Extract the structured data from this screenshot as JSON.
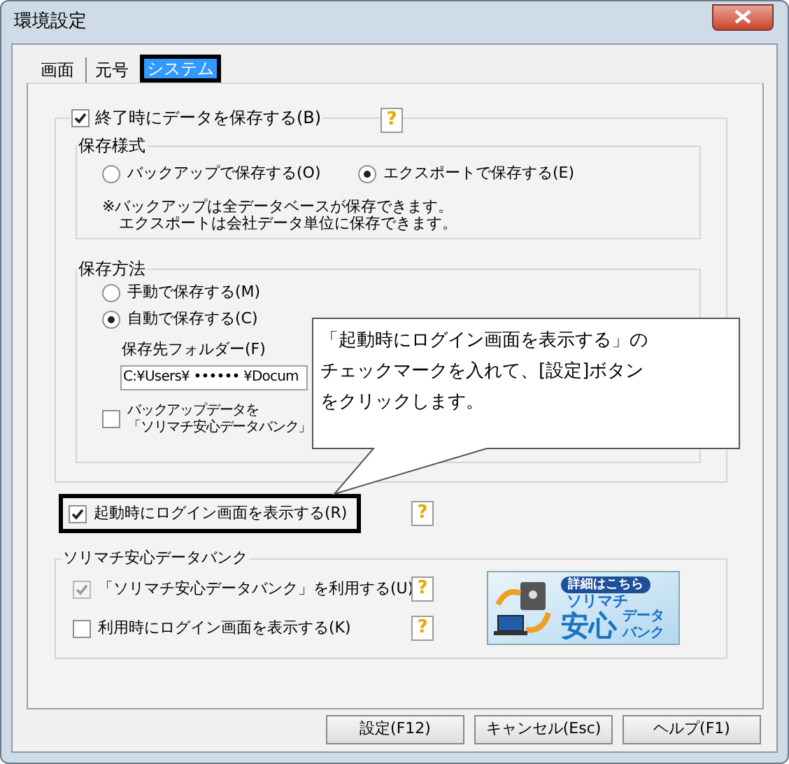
{
  "window": {
    "title": "環境設定"
  },
  "tabs": [
    {
      "label": "画面",
      "selected": false
    },
    {
      "label": "元号",
      "selected": false
    },
    {
      "label": "システム",
      "selected": true
    }
  ],
  "save_on_exit": {
    "label": "終了時にデータを保存する(B)",
    "checked": true,
    "help": "?"
  },
  "save_format": {
    "title": "保存様式",
    "options": [
      {
        "label": "バックアップで保存する(O)",
        "selected": false
      },
      {
        "label": "エクスポートで保存する(E)",
        "selected": true
      }
    ],
    "note": [
      "※バックアップは全データベースが保存できます。",
      "エクスポートは会社データ単位に保存できます。"
    ]
  },
  "save_method": {
    "title": "保存方法",
    "options": [
      {
        "label": "手動で保存する(M)",
        "selected": false
      },
      {
        "label": "自動で保存する(C)",
        "selected": true
      }
    ],
    "folder_label": "保存先フォルダー(F)",
    "folder_value": "C:¥Users¥ •••••• ¥Docum",
    "backup": {
      "label": [
        "バックアップデータを",
        "「ソリマチ安心データバンク」"
      ],
      "checked": false
    }
  },
  "callout": {
    "lines": [
      "「起動時にログイン画面を表示する」の",
      "チェックマークを入れて、[設定]ボタン",
      "をクリックします。"
    ]
  },
  "login_on_start": {
    "label": "起動時にログイン画面を表示する(R)",
    "checked": true,
    "help": "?"
  },
  "databank": {
    "title": "ソリマチ安心データバンク",
    "items": [
      {
        "label": "「ソリマチ安心データバンク」を利用する(U)",
        "checked": true,
        "disabled": true,
        "help": "?"
      },
      {
        "label": "利用時にログイン画面を表示する(K)",
        "checked": false,
        "disabled": false,
        "help": "?"
      }
    ],
    "banner": {
      "badge": "詳細はこちら",
      "brand": "ソリマチ",
      "big": "安心",
      "small_top": "データ",
      "small_bottom": "バンク"
    }
  },
  "buttons": [
    "設定(F12)",
    "キャンセル(Esc)",
    "ヘルプ(F1)"
  ]
}
